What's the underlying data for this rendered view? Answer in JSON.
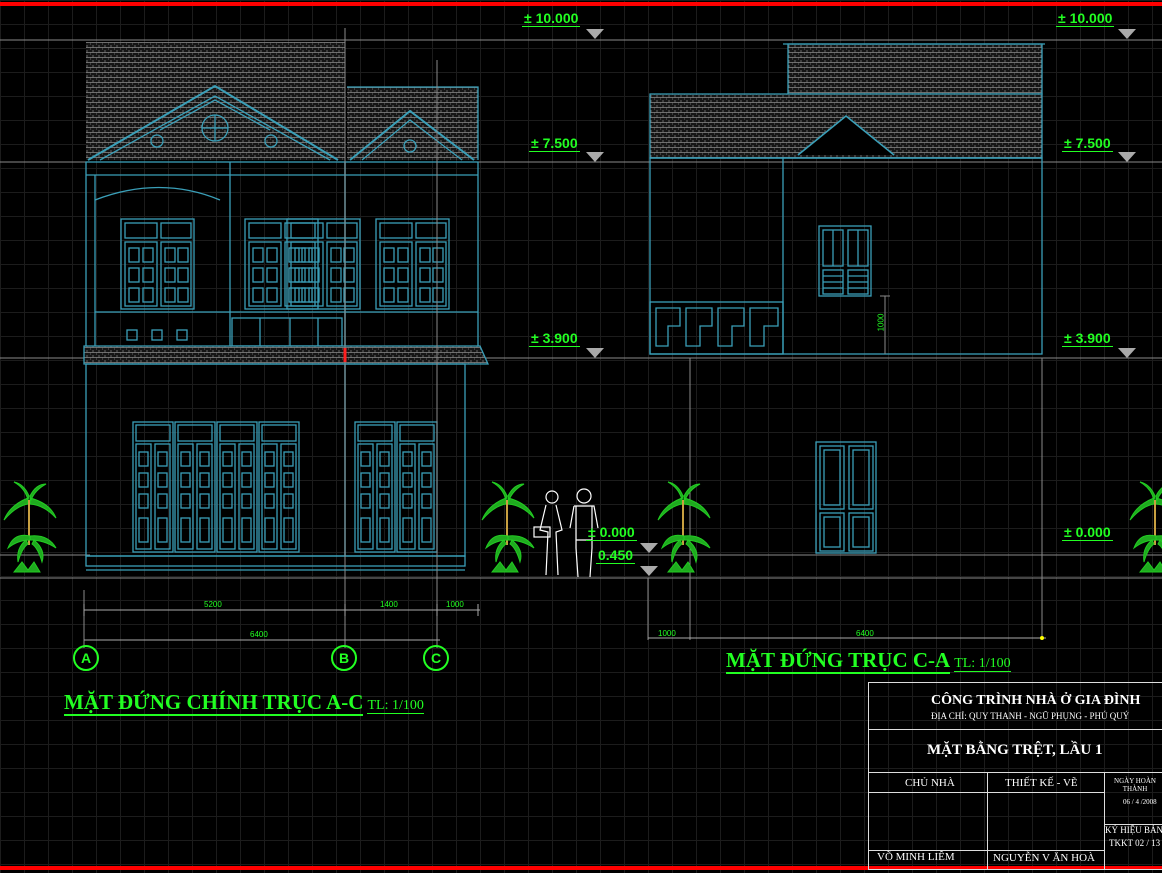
{
  "levels": {
    "left": [
      "± 10.000",
      "± 7.500",
      "± 3.900"
    ],
    "right": [
      "± 10.000",
      "± 7.500",
      "± 3.900",
      "± 0.000"
    ],
    "middle": [
      "± 0.000",
      "0.450"
    ]
  },
  "dimensions": {
    "left_segments": [
      "5200",
      "1400",
      "1000"
    ],
    "left_total": "6400",
    "right_segments": [
      "1000",
      "6400"
    ],
    "vertical": "1000"
  },
  "axes": [
    "A",
    "B",
    "C"
  ],
  "titles": {
    "left_main": "MẶT ĐỨNG CHÍNH TRỤC A-C",
    "left_scale": "TL: 1/100",
    "right_main": "MẶT ĐỨNG TRỤC C-A",
    "right_scale": "TL: 1/100"
  },
  "title_block": {
    "project": "CÔNG TRÌNH NHÀ Ở GIA ĐÌNH",
    "address": "ĐỊA CHỈ: QUY THANH - NGŨ PHỤNG - PHÚ QUÝ",
    "sheet_title": "MẶT BẰNG TRỆT, LẦU 1",
    "owner_label": "CHỦ NHÀ",
    "designer_label": "THIẾT KẾ - VẼ",
    "date_label": "NGÀY HOÀN THÀNH",
    "date_value": "06 / 4 /2008",
    "code_label": "KÝ HIỆU BẢN",
    "code_value": "TKKT 02 / 13",
    "owner_name": "VÕ MINH LIÊM",
    "designer_name": "NGUYỄN V ĂN HOÀ"
  },
  "colors": {
    "background": "#000000",
    "linework": "#3a9fb8",
    "annotation": "#22ff22",
    "border": "#ff0000"
  }
}
